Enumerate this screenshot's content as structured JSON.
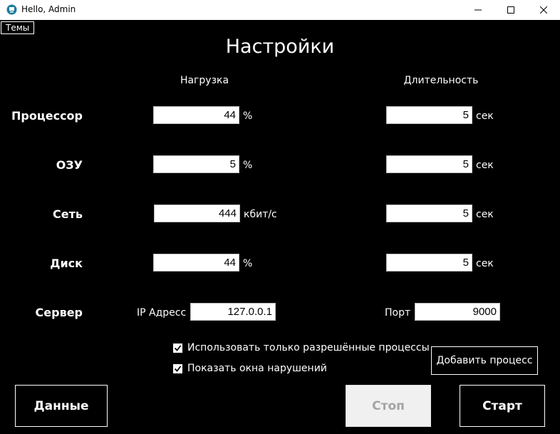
{
  "window": {
    "title": "Hello, Admin",
    "icon": "app-icon",
    "controls": [
      "minimize-icon",
      "maximize-icon",
      "close-icon"
    ]
  },
  "menu": {
    "themes": "Темы"
  },
  "page": {
    "title": "Настройки"
  },
  "columns": {
    "load": "Нагрузка",
    "duration": "Длительность"
  },
  "rows": [
    {
      "label": "Процессор",
      "load": "44",
      "load_unit": "%",
      "duration": "5",
      "duration_unit": "сек"
    },
    {
      "label": "ОЗУ",
      "load": "5",
      "load_unit": "%",
      "duration": "5",
      "duration_unit": "сек"
    },
    {
      "label": "Сеть",
      "load": "444",
      "load_unit": "кбит/с",
      "duration": "5",
      "duration_unit": "сек"
    },
    {
      "label": "Диск",
      "load": "44",
      "load_unit": "%",
      "duration": "5",
      "duration_unit": "сек"
    }
  ],
  "server": {
    "label": "Сервер",
    "ip_label": "IP Адресс",
    "ip": "127.0.0.1",
    "port_label": "Порт",
    "port": "9000"
  },
  "options": [
    {
      "label": "Использовать только разрешённые процессы",
      "checked": true
    },
    {
      "label": "Показать окна нарушений",
      "checked": true
    }
  ],
  "buttons": {
    "add_process": "Добавить процесс",
    "data": "Данные",
    "stop": "Стоп",
    "start": "Старт",
    "stop_enabled": false
  },
  "colors": {
    "background": "#000000",
    "foreground": "#ffffff",
    "disabled_bg": "#f0f0f0",
    "disabled_text": "#a3a3a3"
  }
}
